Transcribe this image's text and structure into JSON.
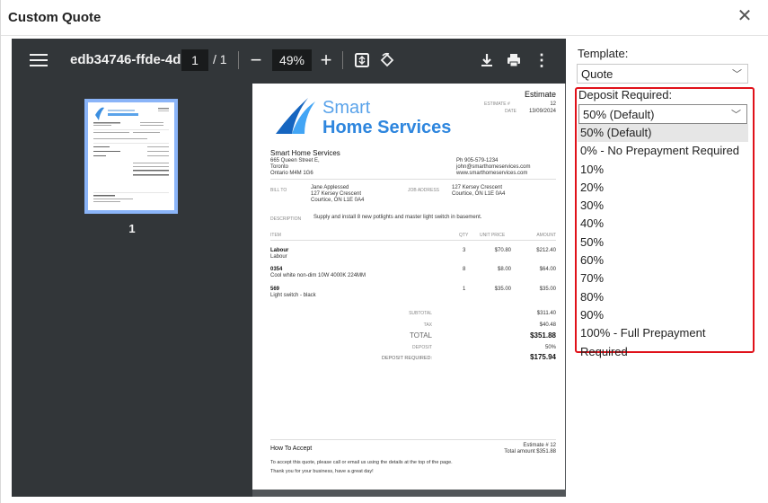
{
  "dialog": {
    "title": "Custom Quote",
    "close_icon": "close-icon"
  },
  "viewer": {
    "filename": "edb34746-ffde-4d...",
    "page_current": "1",
    "page_total": "/ 1",
    "zoom": "49%",
    "thumb_page_number": "1"
  },
  "doc": {
    "logo_line1": "Smart",
    "logo_line2": "Home Services",
    "estimate_title": "Estimate",
    "estimate_no_label": "ESTIMATE #",
    "estimate_no": "12",
    "date_label": "DATE",
    "date": "13/09/2024",
    "company_name": "Smart Home Services",
    "company_addr1": "665 Queen Street E,",
    "company_addr2": "Toronto",
    "company_addr3": "Ontario M4M 1G6",
    "phone": "Ph 905-579-1234",
    "email": "john@smarthomeservices.com",
    "web": "www.smarthomeservices.com",
    "bill_to_label": "BILL TO",
    "bill_name": "Jane Applessed",
    "bill_addr1": "127 Kersey Crescent",
    "bill_addr2": "Courtice, ON L1E 0A4",
    "job_address_label": "JOB ADDRESS",
    "job_addr1": "127 Kersey Crescent",
    "job_addr2": "Courtice, ON L1E 0A4",
    "description_label": "DESCRIPTION",
    "description": "Supply and install 8 new potlights and master light switch in basement.",
    "col_item": "ITEM",
    "col_qty": "QTY",
    "col_unit": "UNIT PRICE",
    "col_amount": "AMOUNT",
    "items": [
      {
        "name": "Labour",
        "desc": "Labour",
        "qty": "3",
        "unit": "$70.80",
        "amount": "$212.40"
      },
      {
        "name": "0354",
        "desc": "Cool white non-dim 10W 4000K 224MM",
        "qty": "8",
        "unit": "$8.00",
        "amount": "$64.00"
      },
      {
        "name": "569",
        "desc": "Light switch - black",
        "qty": "1",
        "unit": "$35.00",
        "amount": "$35.00"
      }
    ],
    "subtotal_label": "SUBTOTAL",
    "subtotal": "$311.40",
    "tax_label": "TAX",
    "tax": "$40.48",
    "total_label": "TOTAL",
    "total": "$351.88",
    "deposit_label": "DEPOSIT",
    "deposit": "50%",
    "deposit_req_label": "DEPOSIT REQUIRED:",
    "deposit_req": "$175.94",
    "how_to_accept": "How To Accept",
    "footer_estimate": "Estimate # 12",
    "footer_total": "Total amount $351.88",
    "footer_text1": "To accept this quote, please call or email us using the details at the top of the page.",
    "footer_text2": "Thank you for your business, have a great day!"
  },
  "settings": {
    "template_label": "Template:",
    "template_value": "Quote",
    "deposit_label": "Deposit Required:",
    "deposit_value": "50% (Default)",
    "deposit_options": [
      "50% (Default)",
      "0% - No Prepayment Required",
      "10%",
      "20%",
      "30%",
      "40%",
      "50%",
      "60%",
      "70%",
      "80%",
      "90%",
      "100% - Full Prepayment Required"
    ],
    "highlight_color": "#e0111a"
  }
}
